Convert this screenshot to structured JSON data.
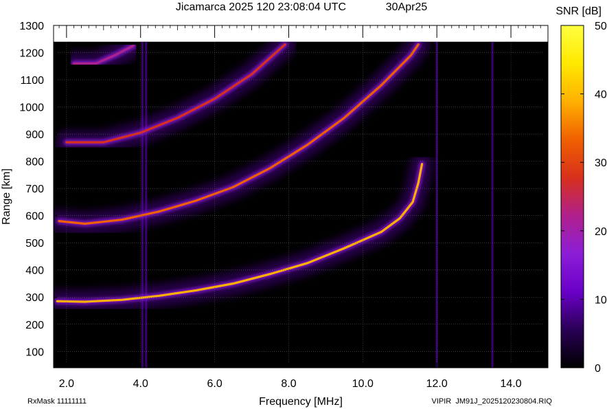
{
  "chart_data": {
    "type": "heatmap",
    "title": "Jicamarca 2025 120 23:08:04 UTC",
    "date_label": "30Apr25",
    "xlabel": "Frequency [MHz]",
    "ylabel": "Range [km]",
    "xlim": [
      1.65,
      15.0
    ],
    "ylim": [
      40,
      1300
    ],
    "xticks": [
      2.0,
      4.0,
      6.0,
      8.0,
      10.0,
      12.0,
      14.0
    ],
    "xtick_labels": [
      "2.0",
      "4.0",
      "6.0",
      "8.0",
      "10.0",
      "12.0",
      "14.0"
    ],
    "yticks": [
      100,
      200,
      300,
      400,
      500,
      600,
      700,
      800,
      900,
      1000,
      1100,
      1200,
      1300
    ],
    "ytick_labels": [
      "100",
      "200",
      "300",
      "400",
      "500",
      "600",
      "700",
      "800",
      "900",
      "1000",
      "1100",
      "1200",
      "1300"
    ],
    "data_top_range_km": 1240,
    "grid": true,
    "colorbar": {
      "label": "SNR [dB]",
      "range": [
        0,
        50
      ],
      "ticks": [
        0,
        10,
        20,
        30,
        40,
        50
      ],
      "tick_labels": [
        "0",
        "10",
        "20",
        "30",
        "40",
        "50"
      ],
      "colormap": [
        "#000000",
        "#2a0055",
        "#6a00c8",
        "#8c1ed8",
        "#b0208c",
        "#d8301c",
        "#f06000",
        "#ffb000",
        "#ffe800",
        "#ffff40"
      ]
    },
    "traces": [
      {
        "name": "",
        "snr_db": 40,
        "points": [
          [
            1.75,
            285
          ],
          [
            2.5,
            283
          ],
          [
            3.5,
            290
          ],
          [
            4.5,
            305
          ],
          [
            5.5,
            325
          ],
          [
            6.5,
            350
          ],
          [
            7.5,
            385
          ],
          [
            8.5,
            425
          ],
          [
            9.5,
            480
          ],
          [
            10.5,
            540
          ],
          [
            11.0,
            590
          ],
          [
            11.35,
            650
          ],
          [
            11.5,
            720
          ],
          [
            11.6,
            790
          ]
        ]
      },
      {
        "name": "",
        "snr_db": 32,
        "points": [
          [
            1.8,
            580
          ],
          [
            2.5,
            570
          ],
          [
            3.5,
            585
          ],
          [
            4.5,
            615
          ],
          [
            5.5,
            655
          ],
          [
            6.5,
            705
          ],
          [
            7.5,
            775
          ],
          [
            8.5,
            860
          ],
          [
            9.5,
            960
          ],
          [
            10.5,
            1080
          ],
          [
            11.3,
            1190
          ],
          [
            11.5,
            1230
          ]
        ]
      },
      {
        "name": "",
        "snr_db": 30,
        "points": [
          [
            2.0,
            870
          ],
          [
            3.0,
            870
          ],
          [
            4.0,
            905
          ],
          [
            5.0,
            960
          ],
          [
            6.0,
            1030
          ],
          [
            7.0,
            1120
          ],
          [
            7.9,
            1230
          ]
        ]
      },
      {
        "name": "",
        "snr_db": 24,
        "points": [
          [
            2.2,
            1160
          ],
          [
            2.8,
            1160
          ],
          [
            3.3,
            1190
          ],
          [
            3.8,
            1225
          ]
        ]
      }
    ],
    "vertical_interference_mhz": [
      4.05,
      4.15,
      12.0,
      13.5
    ]
  },
  "footer": {
    "rxmask": "RxMask 11111111",
    "file": "VIPIR  JM91J_2025120230804.RIQ"
  }
}
